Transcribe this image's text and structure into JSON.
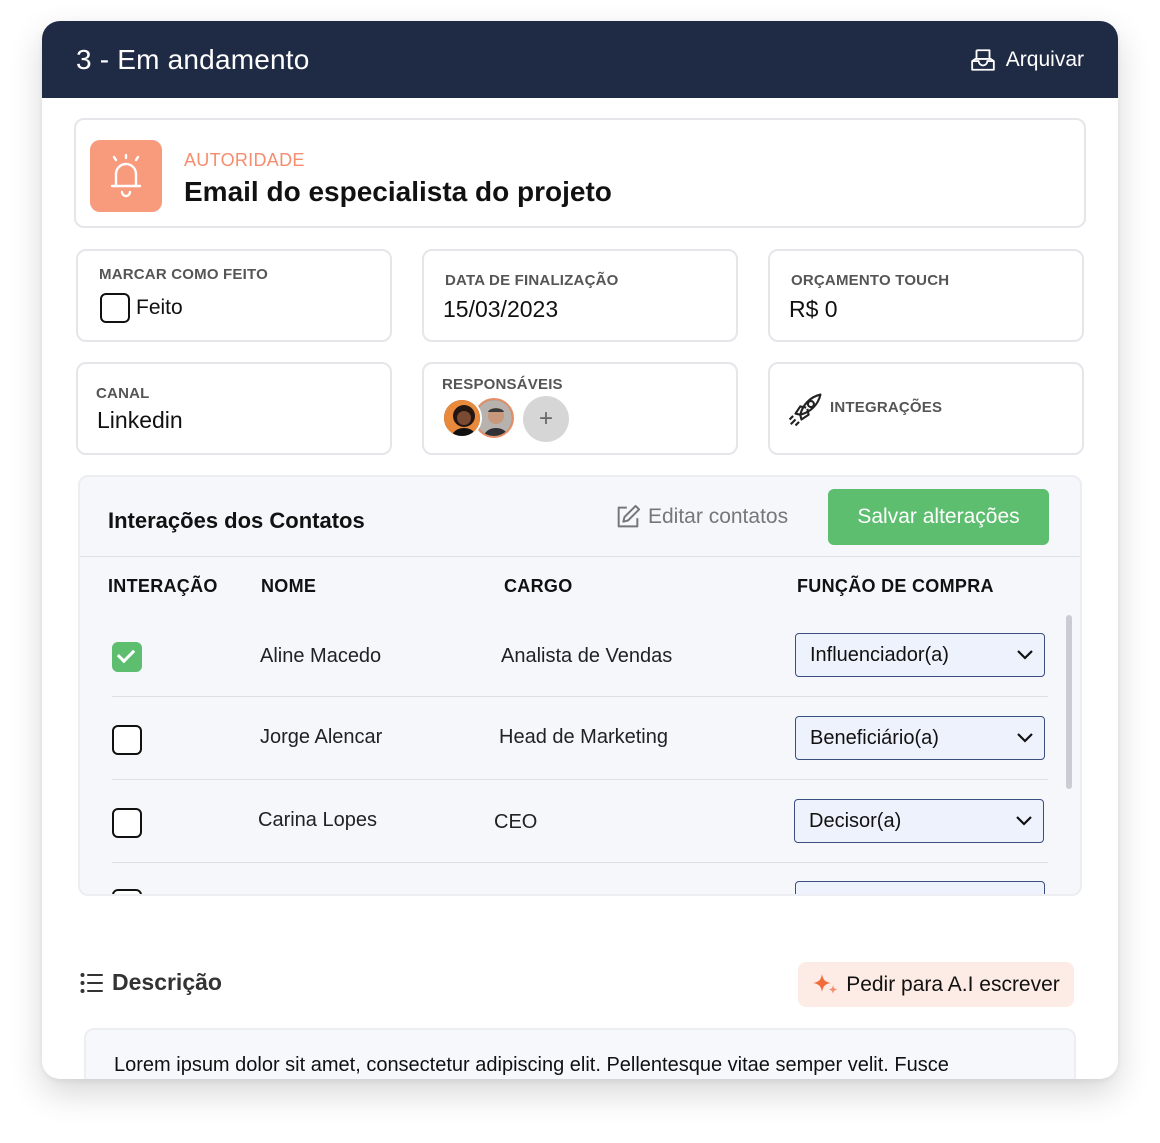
{
  "header": {
    "title": "3 - Em andamento",
    "archive_label": "Arquivar"
  },
  "stage": {
    "kicker": "AUTORIDADE",
    "title": "Email do especialista do projeto",
    "accent": "#f89a7c"
  },
  "fields": {
    "done": {
      "label": "MARCAR COMO FEITO",
      "checkbox_label": "Feito",
      "checked": false
    },
    "end_date": {
      "label": "DATA DE FINALIZAÇÃO",
      "value": "15/03/2023"
    },
    "budget": {
      "label": "ORÇAMENTO TOUCH",
      "value": "R$ 0"
    },
    "channel": {
      "label": "CANAL",
      "value": "Linkedin"
    },
    "owners": {
      "label": "RESPONSÁVEIS",
      "add_symbol": "+"
    },
    "integrations": {
      "label": "INTEGRAÇÕES",
      "icon": "rocket-icon"
    }
  },
  "contacts": {
    "title": "Interações dos Contatos",
    "edit_label": "Editar contatos",
    "save_label": "Salvar alterações",
    "save_color": "#5cbe6e",
    "columns": [
      "INTERAÇÃO",
      "NOME",
      "CARGO",
      "FUNÇÃO DE COMPRA"
    ],
    "rows": [
      {
        "checked": true,
        "name": "Aline Macedo",
        "role": "Analista de Vendas",
        "function": "Influenciador(a)"
      },
      {
        "checked": false,
        "name": "Jorge Alencar",
        "role": "Head de Marketing",
        "function": "Beneficiário(a)"
      },
      {
        "checked": false,
        "name": "Carina Lopes",
        "role": "CEO",
        "function": "Decisor(a)"
      }
    ]
  },
  "description": {
    "title": "Descrição",
    "ai_label": "Pedir para A.I escrever",
    "text": "Lorem ipsum dolor sit amet, consectetur adipiscing elit. Pellentesque vitae semper velit. Fusce"
  }
}
